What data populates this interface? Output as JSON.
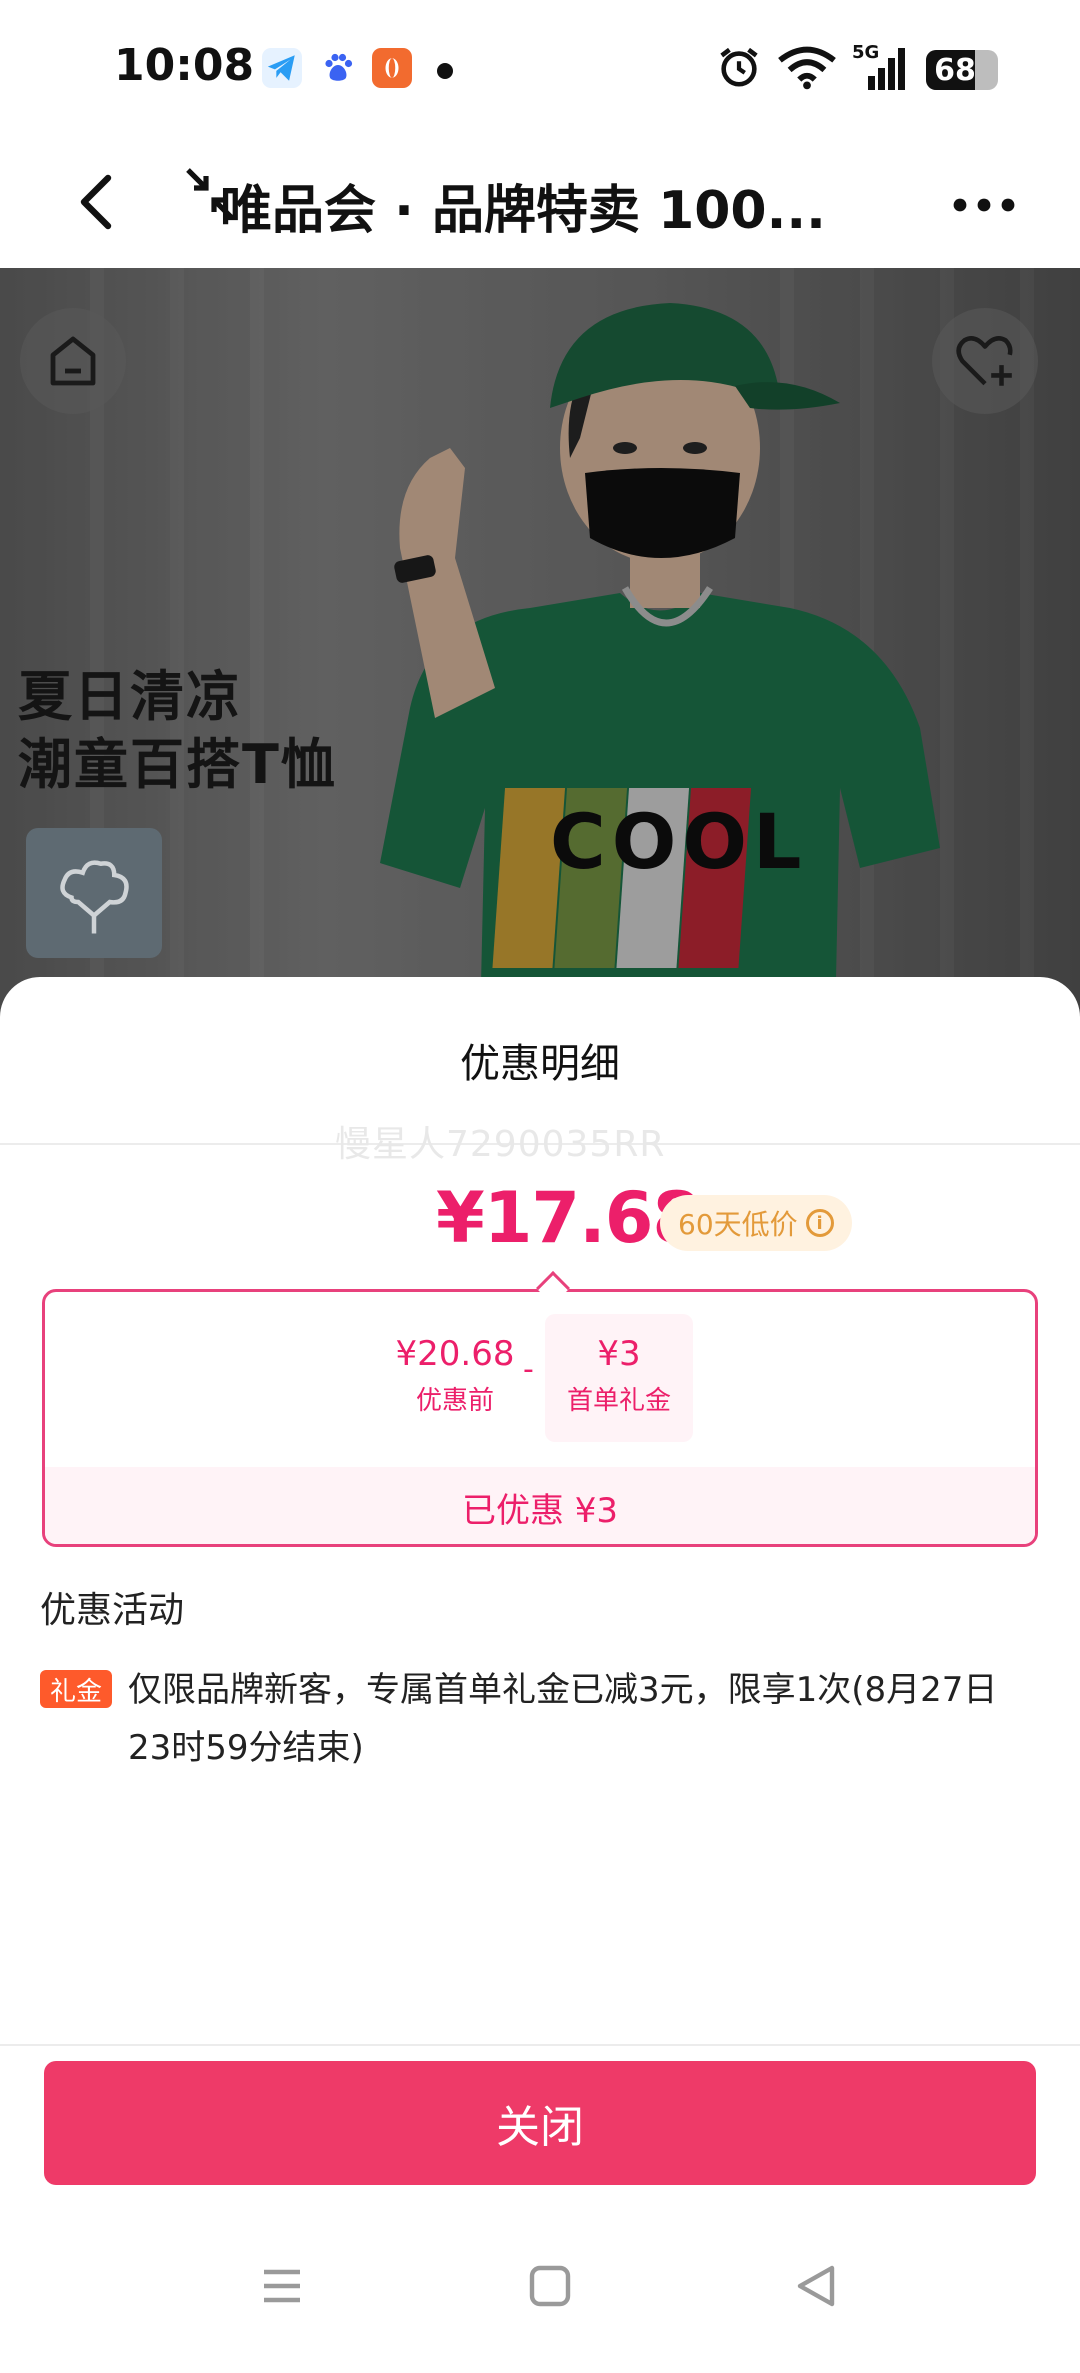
{
  "status_bar": {
    "time": "10:08",
    "battery": "68",
    "network": "5G"
  },
  "header": {
    "title": "唯品会 · 品牌特卖 100..."
  },
  "hero": {
    "headline_line1": "夏日清凉",
    "headline_line2": "潮童百搭T恤",
    "shirt_text": "COOL"
  },
  "sheet": {
    "title": "优惠明细",
    "watermark": "慢星人7290035RR",
    "final_price": "¥17.68",
    "low_price_badge": "60天低价",
    "original_price": "¥20.68",
    "original_label": "优惠前",
    "minus": "-",
    "coupon_value": "¥3",
    "coupon_label": "首单礼金",
    "saved_text": "已优惠 ¥3",
    "section_title": "优惠活动",
    "promo_tag": "礼金",
    "promo_text": "仅限品牌新客，专属首单礼金已减3元，限享1次(8月27日23时59分结束)",
    "close_label": "关闭"
  },
  "colors": {
    "accent": "#ec1f6a",
    "button": "#ee3a68",
    "tag": "#fe5a2b",
    "badge_bg": "#fff2e0",
    "badge_text": "#e39a3a"
  }
}
